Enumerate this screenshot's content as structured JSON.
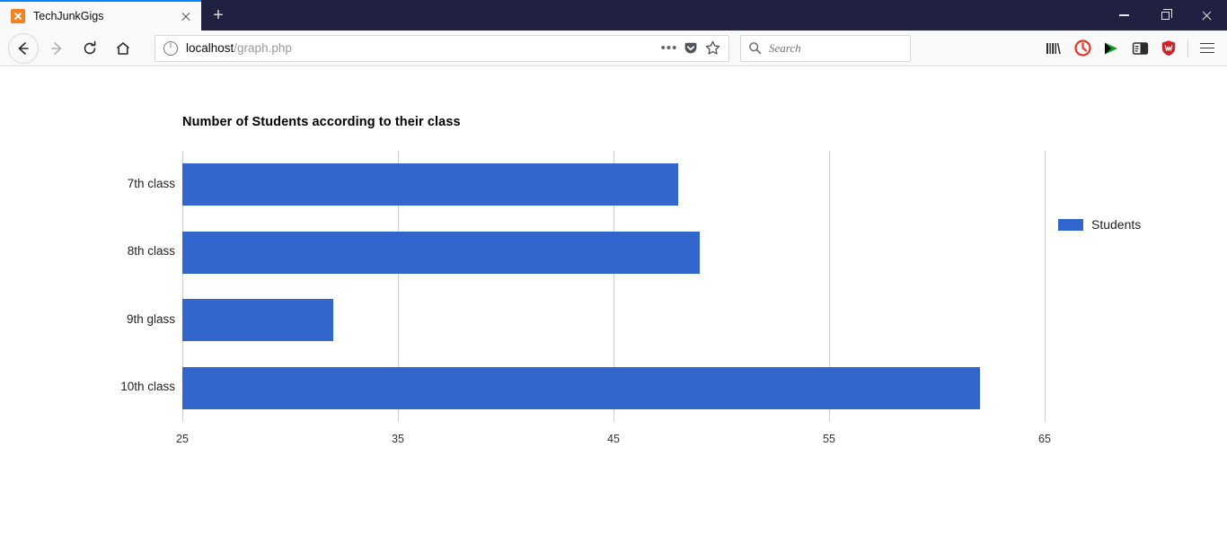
{
  "window": {
    "minimize_label": "Minimize",
    "maximize_label": "Restore",
    "close_label": "Close"
  },
  "tab": {
    "title": "TechJunkGigs",
    "favicon": "xampp-icon",
    "close_label": "Close tab",
    "newtab_label": "New tab"
  },
  "toolbar": {
    "back_label": "Back",
    "forward_label": "Forward",
    "reload_label": "Reload",
    "home_label": "Home",
    "library_label": "Library",
    "adblock_label": "Adblock Plus",
    "videodownload_label": "Video DownloadHelper",
    "reader_label": "Reader View",
    "shield_label": "Security Shield",
    "menu_label": "Open menu"
  },
  "address": {
    "info_label": "Site information",
    "host": "localhost",
    "path": "/graph.php",
    "page_actions_label": "Page actions",
    "pocket_label": "Save to Pocket",
    "bookmark_label": "Bookmark this page"
  },
  "search": {
    "placeholder": "Search",
    "icon": "search-icon"
  },
  "chart_data": {
    "type": "bar",
    "orientation": "horizontal",
    "title": "Number of Students according to their class",
    "categories": [
      "7th class",
      "8th class",
      "9th glass",
      "10th class"
    ],
    "values": [
      48,
      49,
      32,
      62
    ],
    "series": [
      {
        "name": "Students",
        "values": [
          48,
          49,
          32,
          62
        ]
      }
    ],
    "legend": [
      "Students"
    ],
    "legend_position": "right",
    "bar_color": "#3366cc",
    "xlabel": "",
    "ylabel": "",
    "xlim": [
      25,
      65
    ],
    "xticks": [
      25,
      35,
      45,
      55,
      65
    ],
    "xtick_labels": [
      "25",
      "35",
      "45",
      "55",
      "65"
    ],
    "grid": true,
    "grid_axis": "x"
  }
}
